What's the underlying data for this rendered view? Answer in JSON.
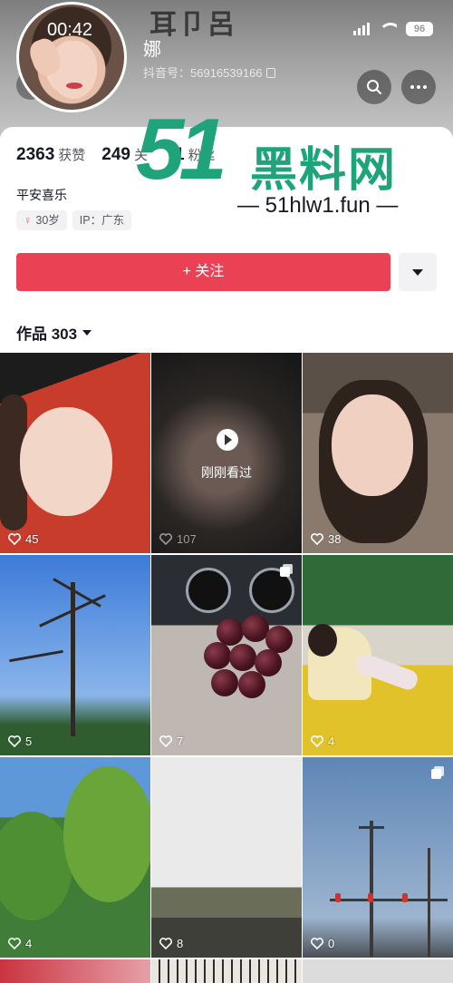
{
  "status_bar": {
    "time": "00:42",
    "battery": "96"
  },
  "header": {
    "doodle_text": "耳卩呂",
    "nickname": "娜",
    "douyin_id": "抖音号：56916539166"
  },
  "profile": {
    "stats": [
      {
        "value": "2363",
        "label": "获赞"
      },
      {
        "value": "249",
        "label": "关"
      },
      {
        "value": "1",
        "label": "粉丝"
      }
    ],
    "bio": "平安喜乐",
    "tags": [
      {
        "icon": "female-symbol",
        "text": "30岁"
      },
      {
        "text": "IP：广东"
      }
    ],
    "follow_label": "+ 关注",
    "works_label": "作品 303"
  },
  "watermark": {
    "number": "51",
    "site_name": "黑料网",
    "url": "— 51hlw1.fun —"
  },
  "grid": [
    {
      "likes": "45",
      "name": "red-hood-selfie"
    },
    {
      "likes": "107",
      "overlay": "刚刚看过",
      "name": "dark-selfie-video"
    },
    {
      "likes": "38",
      "name": "car-selfie"
    },
    {
      "likes": "5",
      "name": "bare-tree-sky"
    },
    {
      "likes": "7",
      "multi": true,
      "name": "cherries-in-car"
    },
    {
      "likes": "4",
      "name": "child-on-slide"
    },
    {
      "likes": "4",
      "name": "green-trees"
    },
    {
      "likes": "8",
      "name": "hazy-river"
    },
    {
      "likes": "0",
      "multi": true,
      "name": "traffic-lights"
    }
  ],
  "colors": {
    "follow_button": "#ea4154",
    "watermark_green": "#1fa37a",
    "female_pink": "#ff4b8b"
  }
}
